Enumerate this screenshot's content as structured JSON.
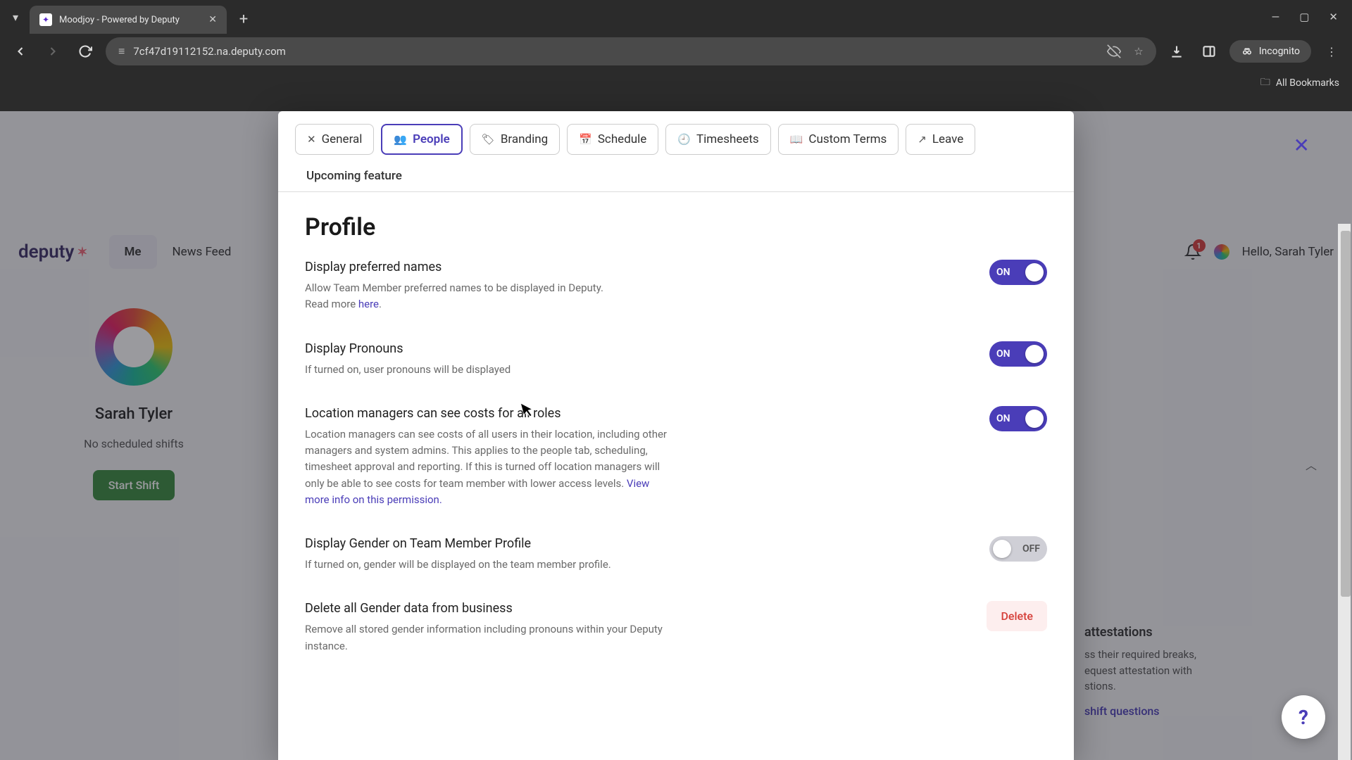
{
  "browser": {
    "tab_title": "Moodjoy - Powered by Deputy",
    "url": "7cf47d19112152.na.deputy.com",
    "incognito_label": "Incognito",
    "all_bookmarks": "All Bookmarks"
  },
  "dep": {
    "logo": "deputy",
    "nav": [
      "Me",
      "News Feed"
    ],
    "greeting": "Hello, Sarah Tyler",
    "notif_count": "1"
  },
  "left": {
    "user": "Sarah Tyler",
    "no_shifts": "No scheduled shifts",
    "start_shift": "Start Shift"
  },
  "right_peek": {
    "heading": "attestations",
    "body1": "ss their required breaks,",
    "body2": "equest attestation with",
    "body3": "stions.",
    "link": "shift questions"
  },
  "modal": {
    "tabs": {
      "general": "General",
      "people": "People",
      "branding": "Branding",
      "schedule": "Schedule",
      "timesheets": "Timesheets",
      "custom_terms": "Custom Terms",
      "leave": "Leave",
      "upcoming": "Upcoming feature"
    },
    "section_title": "Profile",
    "settings": {
      "preferred": {
        "label": "Display preferred names",
        "desc": "Allow Team Member preferred names to be displayed in Deputy.",
        "readmore_prefix": "Read more ",
        "readmore_link": "here",
        "readmore_suffix": ".",
        "state": "ON"
      },
      "pronouns": {
        "label": "Display Pronouns",
        "desc": "If turned on, user pronouns will be displayed",
        "state": "ON"
      },
      "costs": {
        "label": "Location managers can see costs for all roles",
        "desc": "Location managers can see costs of all users in their location, including other managers and system admins. This applies to the people tab, scheduling, timesheet approval and reporting. If this is turned off location managers will only be able to see costs for team member with lower access levels. ",
        "link": "View more info on this permission.",
        "state": "ON"
      },
      "gender": {
        "label": "Display Gender on Team Member Profile",
        "desc": "If turned on, gender will be displayed on the team member profile.",
        "state": "OFF"
      },
      "delete_gender": {
        "label": "Delete all Gender data from business",
        "desc": "Remove all stored gender information including pronouns within your Deputy instance.",
        "button": "Delete"
      }
    }
  }
}
